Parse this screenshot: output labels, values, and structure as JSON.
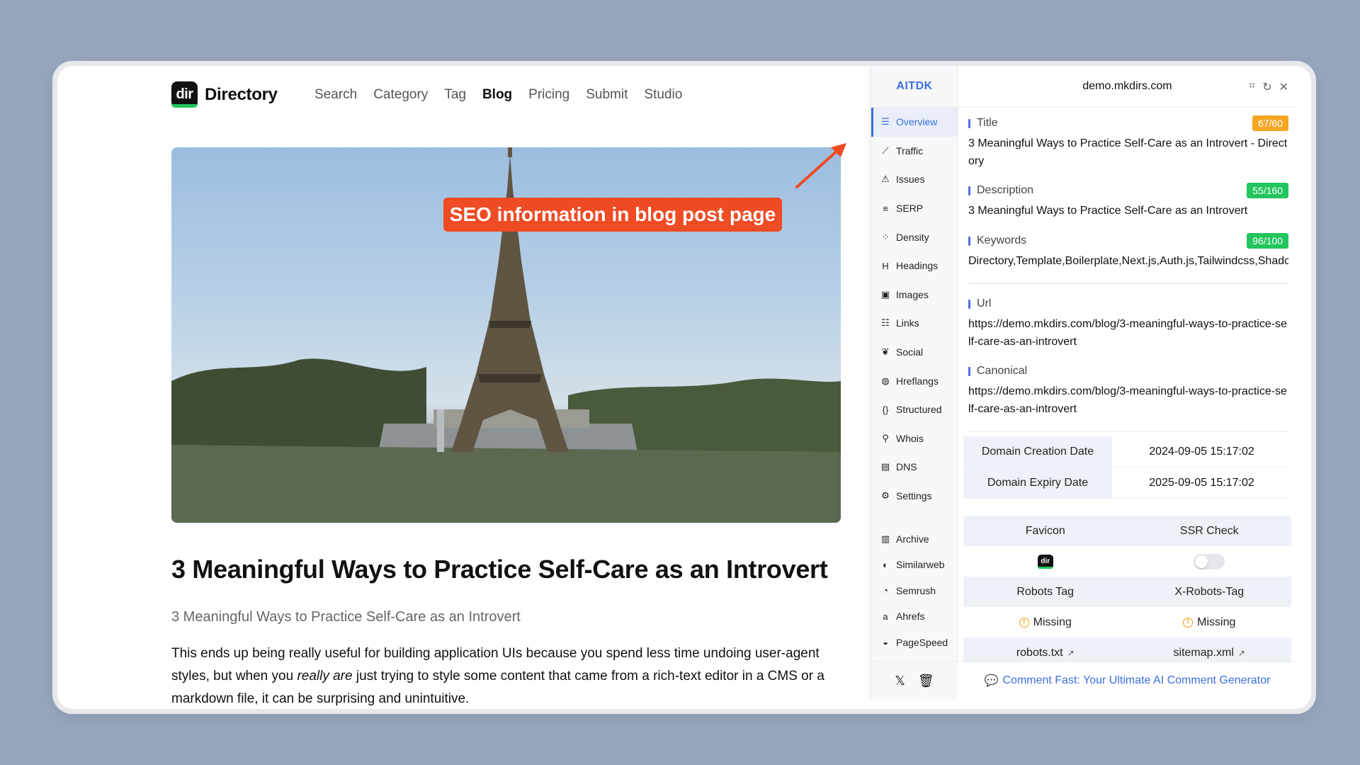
{
  "site": {
    "logo_mark": "dir",
    "brand": "Directory",
    "nav": [
      {
        "label": "Search",
        "active": false
      },
      {
        "label": "Category",
        "active": false
      },
      {
        "label": "Tag",
        "active": false
      },
      {
        "label": "Blog",
        "active": true
      },
      {
        "label": "Pricing",
        "active": false
      },
      {
        "label": "Submit",
        "active": false
      },
      {
        "label": "Studio",
        "active": false
      }
    ]
  },
  "callout": "SEO information in blog post page",
  "post": {
    "title": "3 Meaningful Ways to Practice Self-Care as an Introvert",
    "subtitle": "3 Meaningful Ways to Practice Self-Care as an Introvert",
    "body_a": "This ends up being really useful for building application UIs because you spend less time undoing user-agent styles, but when you ",
    "body_em": "really are",
    "body_b": " just trying to style some content that came from a rich-text editor in a CMS or a markdown file, it can be surprising and unintuitive."
  },
  "panel": {
    "brand": "AITDK",
    "domain": "demo.mkdirs.com",
    "menu": [
      {
        "label": "Overview",
        "icon": "list-icon",
        "glyph": "☰",
        "active": true
      },
      {
        "label": "Traffic",
        "icon": "line-chart-icon",
        "glyph": "⟋",
        "active": false
      },
      {
        "label": "Issues",
        "icon": "warning-icon",
        "glyph": "⚠",
        "active": false
      },
      {
        "label": "SERP",
        "icon": "serp-icon",
        "glyph": "≡",
        "active": false
      },
      {
        "label": "Density",
        "icon": "scatter-icon",
        "glyph": "⁘",
        "active": false
      },
      {
        "label": "Headings",
        "icon": "heading-icon",
        "glyph": "H",
        "active": false
      },
      {
        "label": "Images",
        "icon": "image-icon",
        "glyph": "▣",
        "active": false
      },
      {
        "label": "Links",
        "icon": "links-icon",
        "glyph": "☷",
        "active": false
      },
      {
        "label": "Social",
        "icon": "twitter-bird-icon",
        "glyph": "❦",
        "active": false
      },
      {
        "label": "Hreflangs",
        "icon": "globe-icon",
        "glyph": "◍",
        "active": false
      },
      {
        "label": "Structured",
        "icon": "braces-icon",
        "glyph": "{}",
        "active": false
      },
      {
        "label": "Whois",
        "icon": "user-search-icon",
        "glyph": "⚲",
        "active": false
      },
      {
        "label": "DNS",
        "icon": "server-icon",
        "glyph": "▤",
        "active": false
      },
      {
        "label": "Settings",
        "icon": "gear-icon",
        "glyph": "⚙",
        "active": false
      }
    ],
    "external": [
      {
        "label": "Archive",
        "icon": "archive-icon",
        "glyph": "▥"
      },
      {
        "label": "Similarweb",
        "icon": "similarweb-icon",
        "glyph": "◐"
      },
      {
        "label": "Semrush",
        "icon": "semrush-icon",
        "glyph": "◔"
      },
      {
        "label": "Ahrefs",
        "icon": "ahrefs-icon",
        "glyph": "a"
      },
      {
        "label": "PageSpeed",
        "icon": "pagespeed-icon",
        "glyph": "◒"
      }
    ],
    "title": {
      "label": "Title",
      "badge": "67/60",
      "badge_color": "#f5a623",
      "value": "3 Meaningful Ways to Practice Self-Care as an Introvert - Directory"
    },
    "description": {
      "label": "Description",
      "badge": "55/160",
      "badge_color": "#22c55e",
      "value": "3 Meaningful Ways to Practice Self-Care as an Introvert"
    },
    "keywords": {
      "label": "Keywords",
      "badge": "96/100",
      "badge_color": "#22c55e",
      "value": "Directory,Template,Boilerplate,Next.js,Auth.js,Tailwindcss,Shadcn"
    },
    "url": {
      "label": "Url",
      "value": "https://demo.mkdirs.com/blog/3-meaningful-ways-to-practice-self-care-as-an-introvert"
    },
    "canonical": {
      "label": "Canonical",
      "value": "https://demo.mkdirs.com/blog/3-meaningful-ways-to-practice-self-care-as-an-introvert"
    },
    "domain_info": [
      {
        "key": "Domain Creation Date",
        "value": "2024-09-05 15:17:02"
      },
      {
        "key": "Domain Expiry Date",
        "value": "2025-09-05 15:17:02"
      }
    ],
    "checks": {
      "favicon_label": "Favicon",
      "ssr_label": "SSR Check",
      "robots_label": "Robots Tag",
      "xrobots_label": "X-Robots-Tag",
      "robots_value": "Missing",
      "xrobots_value": "Missing",
      "robots_txt": "robots.txt",
      "sitemap": "sitemap.xml",
      "ssr_enabled": false
    },
    "footer_link": "Comment Fast: Your Ultimate AI Comment Generator"
  }
}
